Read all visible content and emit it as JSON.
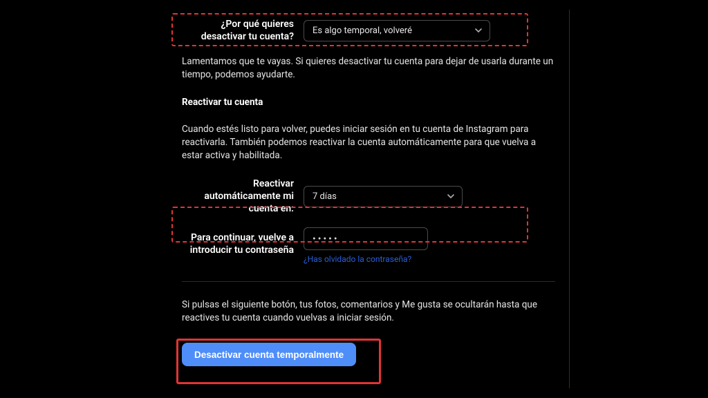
{
  "reason": {
    "label": "¿Por qué quieres desactivar tu cuenta?",
    "selected": "Es algo temporal, volveré"
  },
  "paragraph1": "Lamentamos que te vayas. Si quieres desactivar tu cuenta para dejar de usarla durante un tiempo, podemos ayudarte.",
  "reactivateHeading": "Reactivar tu cuenta",
  "paragraph2": "Cuando estés listo para volver, puedes iniciar sesión en tu cuenta de Instagram para reactivarla. También podemos reactivar la cuenta automáticamente para que vuelva a estar activa y habilitada.",
  "autoReactivate": {
    "label": "Reactivar automáticamente mi cuenta en:",
    "selected": "7 días"
  },
  "password": {
    "label": "Para continuar, vuelve a introducir tu contraseña",
    "masked": "•••••",
    "forgotLink": "¿Has olvidado la contraseña?"
  },
  "confirmParagraph": "Si pulsas el siguiente botón, tus fotos, comentarios y Me gusta se ocultarán hasta que reactives tu cuenta cuando vuelvas a iniciar sesión.",
  "submitLabel": "Desactivar cuenta temporalmente"
}
